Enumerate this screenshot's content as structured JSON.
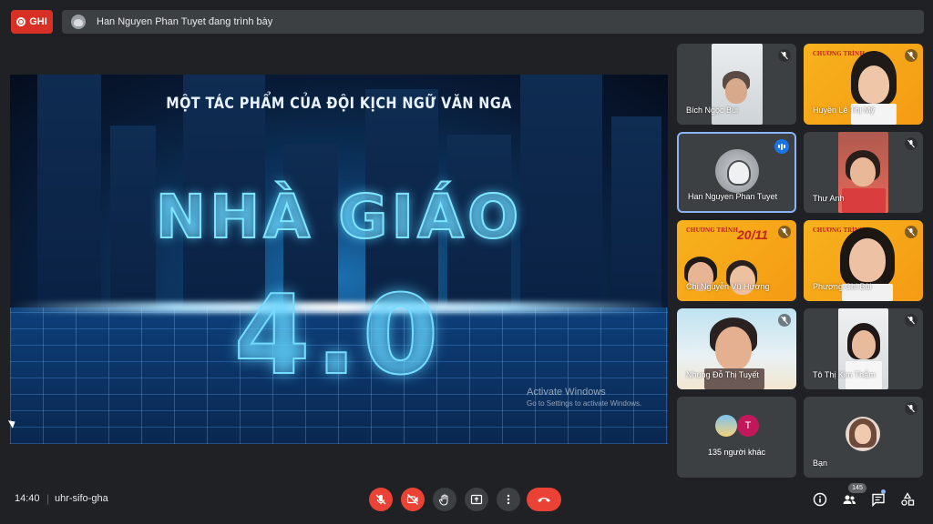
{
  "header": {
    "record_label": "GHI",
    "presenting_text": "Han Nguyen Phan Tuyet đang trình bày"
  },
  "slide": {
    "subtitle": "MỘT TÁC PHẨM CỦA ĐỘI KỊCH NGỮ VĂN NGA",
    "title": "NHÀ GIÁO",
    "number": "4.0"
  },
  "watermark": {
    "line1": "Activate Windows",
    "line2": "Go to Settings to activate Windows."
  },
  "participants": [
    {
      "name": "Bích Ngọc Bùi",
      "mic": "off"
    },
    {
      "name": "Huyền Lê Thị Mỹ",
      "mic": "off"
    },
    {
      "name": "Han Nguyen Phan Tuyet",
      "mic": "speaking"
    },
    {
      "name": "Thư Anh",
      "mic": "off"
    },
    {
      "name": "Chi Nguyễn Vũ Hương",
      "mic": "off"
    },
    {
      "name": "Phương Chi Bùi",
      "mic": "off"
    },
    {
      "name": "Nhung Đỗ Thị Tuyết",
      "mic": "off"
    },
    {
      "name": "Tô Thị Kim Thắm",
      "mic": "off"
    },
    {
      "name": "135 người khác",
      "mic": "none"
    },
    {
      "name": "Bạn",
      "mic": "off"
    }
  ],
  "overflow_initial": "T",
  "yellow_banner": "CHƯƠNG TRÌNH",
  "yellow_date": "20/11",
  "footer": {
    "time": "14:40",
    "separator": "|",
    "meeting_code": "uhr-sifo-gha",
    "people_count": "145"
  },
  "colors": {
    "background": "#202124",
    "tile": "#3c4043",
    "danger": "#ea4335",
    "accent": "#8ab4f8",
    "record": "#d93025"
  },
  "icons": [
    "record-icon",
    "mic-off-icon",
    "camera-off-icon",
    "raise-hand-icon",
    "present-icon",
    "more-options-icon",
    "hang-up-icon",
    "info-icon",
    "people-icon",
    "chat-icon",
    "activities-icon"
  ]
}
